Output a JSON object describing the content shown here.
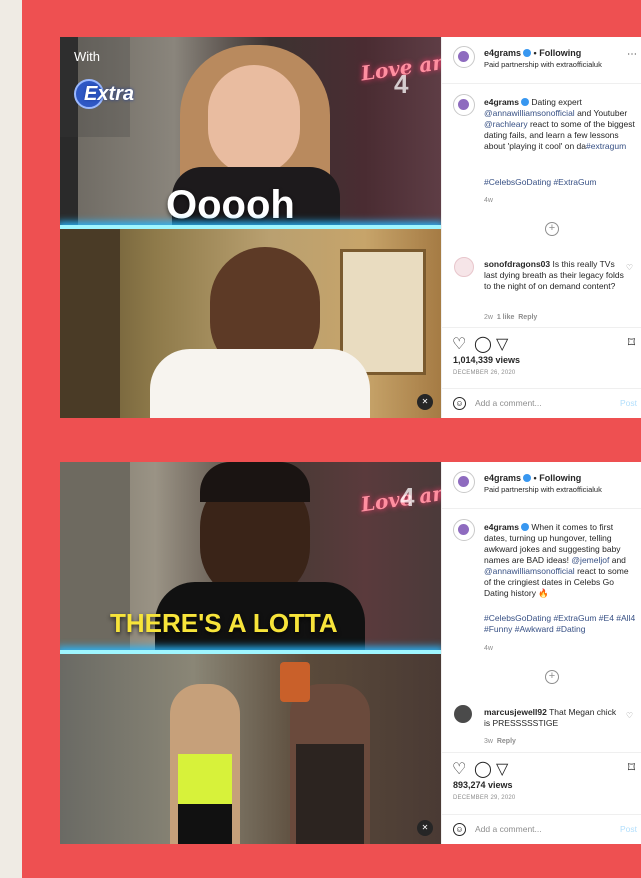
{
  "posts": [
    {
      "video": {
        "badge_text": "With",
        "brand_logo": "Extra",
        "neon_sign": "Love and Laughter",
        "watermark": "4",
        "overlay_text": "Ooooh",
        "mute_icon": "speaker-muted-icon"
      },
      "header": {
        "username": "e4grams",
        "follow_label": "Following",
        "partnership": "Paid partnership with extraofficialuk",
        "more_icon": "more-icon"
      },
      "caption": {
        "username": "e4grams",
        "text_1": "Dating expert",
        "mention_1": "@annawilliamsonofficial",
        "text_2": "and Youtuber",
        "mention_2": "@rachleary",
        "text_3": "react to some of the biggest dating fails, and learn a few lessons about 'playing it cool' on da",
        "mention_3": "#extragum",
        "hashtags": "#CelebsGoDating #ExtraGum",
        "time_ago": "4w"
      },
      "comment": {
        "username": "sonofdragons03",
        "text": "Is this really TVs last dying breath as their legacy folds to the night of on demand content?",
        "time": "2w",
        "likes": "1 like",
        "reply": "Reply"
      },
      "views": "1,014,339 views",
      "date": "DECEMBER 26, 2020",
      "add_comment_placeholder": "Add a comment...",
      "post_label": "Post"
    },
    {
      "video": {
        "neon_sign": "Love and Laughter",
        "watermark": "4",
        "overlay_text": "THERE'S A LOTTA",
        "mute_icon": "speaker-muted-icon"
      },
      "header": {
        "username": "e4grams",
        "follow_label": "Following",
        "partnership": "Paid partnership with extraofficialuk",
        "more_icon": "more-icon"
      },
      "caption": {
        "username": "e4grams",
        "text_1": "When it comes to first dates, turning up hungover, telling awkward jokes and suggesting baby names are BAD ideas!",
        "mention_1": "@jemeljof",
        "text_2": "and",
        "mention_2": "@annawilliamsonofficial",
        "text_3": "react to some of the cringiest dates in Celebs Go Dating history",
        "emoji": "🔥",
        "hashtags": "#CelebsGoDating #ExtraGum #E4 #All4 #Funny #Awkward #Dating",
        "time_ago": "4w"
      },
      "comment": {
        "username": "marcusjewell92",
        "text": "That Megan chick is PRESSSSSTIGE",
        "time": "3w",
        "reply": "Reply"
      },
      "views": "893,274 views",
      "date": "DECEMBER 29, 2020",
      "add_comment_placeholder": "Add a comment...",
      "post_label": "Post"
    }
  ],
  "colors": {
    "panel": "#ee5051",
    "page": "#efebe4",
    "link": "#385185",
    "overlay_yellow": "#f7e43a",
    "glow": "#27b8ff"
  }
}
